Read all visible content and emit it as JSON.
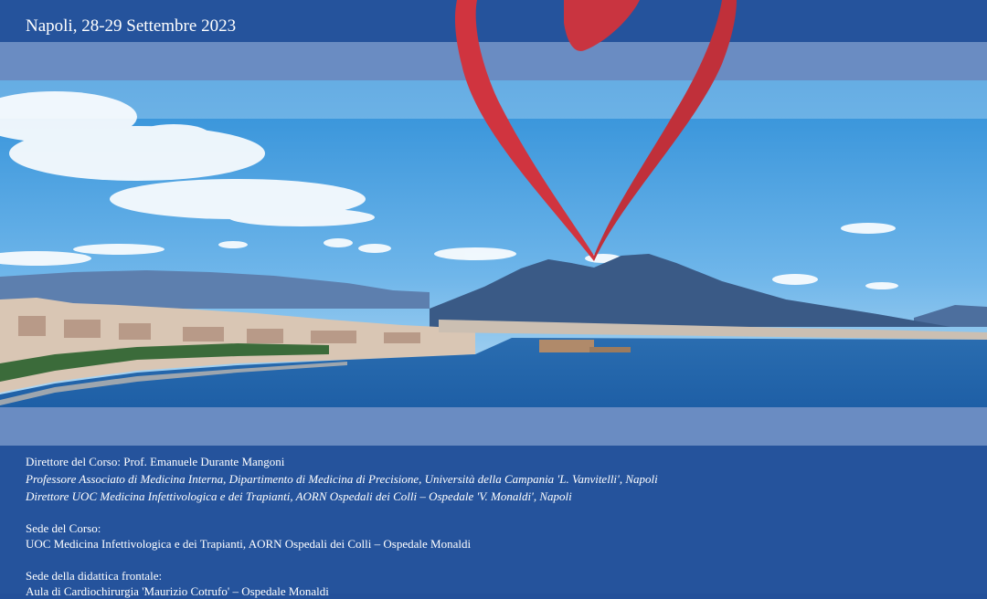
{
  "header": {
    "date_place": "Napoli, 28-29 Settembre 2023"
  },
  "course": {
    "director_line": "Direttore del Corso: Prof. Emanuele Durante Mangoni",
    "director_role_1": "Professore Associato di Medicina Interna, Dipartimento di Medicina di Precisione, Università della Campania 'L. Vanvitelli', Napoli",
    "director_role_2": "Direttore UOC Medicina Infettivologica e dei Trapianti, AORN Ospedali dei Colli – Ospedale 'V. Monaldi', Napoli",
    "venue_label": "Sede del Corso:",
    "venue_value": "UOC Medicina Infettivologica e dei Trapianti, AORN Ospedali dei Colli – Ospedale Monaldi",
    "teaching_label": "Sede della didattica frontale:",
    "teaching_value": "Aula di Cardiochirurgia 'Maurizio Cotrufo' – Ospedale Monaldi"
  },
  "colors": {
    "band_dark": "#25539c",
    "band_light": "#6a8cc2",
    "heart": "#d0343f"
  }
}
